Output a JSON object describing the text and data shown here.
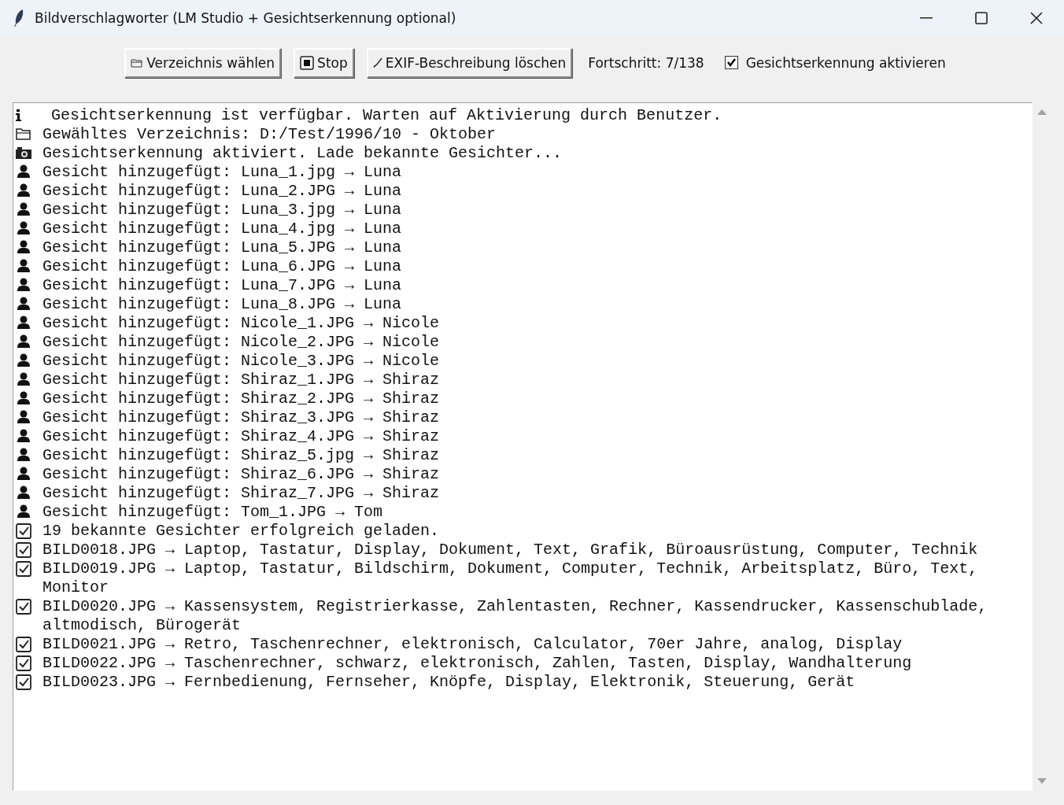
{
  "window": {
    "title": "Bildverschlagworter (LM Studio + Gesichtserkennung optional)"
  },
  "toolbar": {
    "buttons": [
      {
        "kind": "folder",
        "label": "Verzeichnis wählen"
      },
      {
        "kind": "stop",
        "label": "Stop"
      },
      {
        "kind": "brush",
        "label": "EXIF-Beschreibung löschen"
      }
    ],
    "progress": "Fortschritt: 7/138",
    "face_detection": {
      "label": "Gesichtserkennung aktivieren",
      "checked": true
    }
  },
  "log": [
    {
      "kind": "info",
      "text": "Gesichtserkennung ist verfügbar. Warten auf Aktivierung durch Benutzer."
    },
    {
      "kind": "folder",
      "text": "Gewähltes Verzeichnis: D:/Test/1996/10 - Oktober"
    },
    {
      "kind": "camera",
      "text": "Gesichtserkennung aktiviert. Lade bekannte Gesichter..."
    },
    {
      "kind": "person",
      "text": "Gesicht hinzugefügt: Luna_1.jpg → Luna"
    },
    {
      "kind": "person",
      "text": "Gesicht hinzugefügt: Luna_2.JPG → Luna"
    },
    {
      "kind": "person",
      "text": "Gesicht hinzugefügt: Luna_3.jpg → Luna"
    },
    {
      "kind": "person",
      "text": "Gesicht hinzugefügt: Luna_4.jpg → Luna"
    },
    {
      "kind": "person",
      "text": "Gesicht hinzugefügt: Luna_5.JPG → Luna"
    },
    {
      "kind": "person",
      "text": "Gesicht hinzugefügt: Luna_6.JPG → Luna"
    },
    {
      "kind": "person",
      "text": "Gesicht hinzugefügt: Luna_7.JPG → Luna"
    },
    {
      "kind": "person",
      "text": "Gesicht hinzugefügt: Luna_8.JPG → Luna"
    },
    {
      "kind": "person",
      "text": "Gesicht hinzugefügt: Nicole_1.JPG → Nicole"
    },
    {
      "kind": "person",
      "text": "Gesicht hinzugefügt: Nicole_2.JPG → Nicole"
    },
    {
      "kind": "person",
      "text": "Gesicht hinzugefügt: Nicole_3.JPG → Nicole"
    },
    {
      "kind": "person",
      "text": "Gesicht hinzugefügt: Shiraz_1.JPG → Shiraz"
    },
    {
      "kind": "person",
      "text": "Gesicht hinzugefügt: Shiraz_2.JPG → Shiraz"
    },
    {
      "kind": "person",
      "text": "Gesicht hinzugefügt: Shiraz_3.JPG → Shiraz"
    },
    {
      "kind": "person",
      "text": "Gesicht hinzugefügt: Shiraz_4.JPG → Shiraz"
    },
    {
      "kind": "person",
      "text": "Gesicht hinzugefügt: Shiraz_5.jpg → Shiraz"
    },
    {
      "kind": "person",
      "text": "Gesicht hinzugefügt: Shiraz_6.JPG → Shiraz"
    },
    {
      "kind": "person",
      "text": "Gesicht hinzugefügt: Shiraz_7.JPG → Shiraz"
    },
    {
      "kind": "person",
      "text": "Gesicht hinzugefügt: Tom_1.JPG → Tom"
    },
    {
      "kind": "check",
      "text": "19 bekannte Gesichter erfolgreich geladen."
    },
    {
      "kind": "check",
      "text": "BILD0018.JPG → Laptop, Tastatur, Display, Dokument, Text, Grafik, Büroausrüstung, Computer, Technik"
    },
    {
      "kind": "check",
      "text": "BILD0019.JPG → Laptop, Tastatur, Bildschirm, Dokument, Computer, Technik, Arbeitsplatz, Büro, Text, Monitor"
    },
    {
      "kind": "check",
      "text": "BILD0020.JPG → Kassensystem, Registrierkasse, Zahlentasten, Rechner, Kassendrucker, Kassenschublade, altmodisch, Bürogerät"
    },
    {
      "kind": "check",
      "text": "BILD0021.JPG → Retro, Taschenrechner, elektronisch, Calculator, 70er Jahre, analog, Display"
    },
    {
      "kind": "check",
      "text": "BILD0022.JPG → Taschenrechner, schwarz, elektronisch, Zahlen, Tasten, Display, Wandhalterung"
    },
    {
      "kind": "check",
      "text": "BILD0023.JPG → Fernbedienung, Fernseher, Knöpfe, Display, Elektronik, Steuerung, Gerät"
    }
  ]
}
